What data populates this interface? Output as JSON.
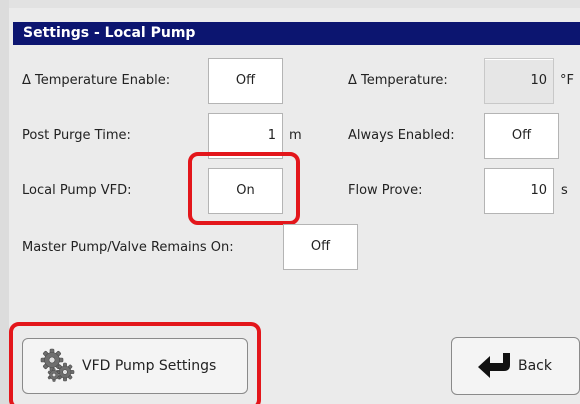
{
  "window": {
    "title": "Settings - Local Pump"
  },
  "fields": {
    "delta_temp_enable": {
      "label": "Δ Temperature Enable:",
      "value": "Off"
    },
    "delta_temperature": {
      "label": "Δ Temperature:",
      "value": "10",
      "unit": "°F"
    },
    "post_purge_time": {
      "label": "Post Purge Time:",
      "value": "1",
      "unit": "m"
    },
    "always_enabled": {
      "label": "Always Enabled:",
      "value": "Off"
    },
    "local_pump_vfd": {
      "label": "Local Pump VFD:",
      "value": "On"
    },
    "flow_prove": {
      "label": "Flow Prove:",
      "value": "10",
      "unit": "s"
    },
    "master_pump_valve": {
      "label": "Master Pump/Valve Remains On:",
      "value": "Off"
    }
  },
  "buttons": {
    "vfd_pump_settings": {
      "label": "VFD Pump Settings",
      "icon": "gears-icon"
    },
    "back": {
      "label": "Back",
      "icon": "back-arrow-icon"
    }
  },
  "colors": {
    "title_bar": "#0c1570",
    "highlight": "#e3161b",
    "background": "#ebebeb"
  }
}
